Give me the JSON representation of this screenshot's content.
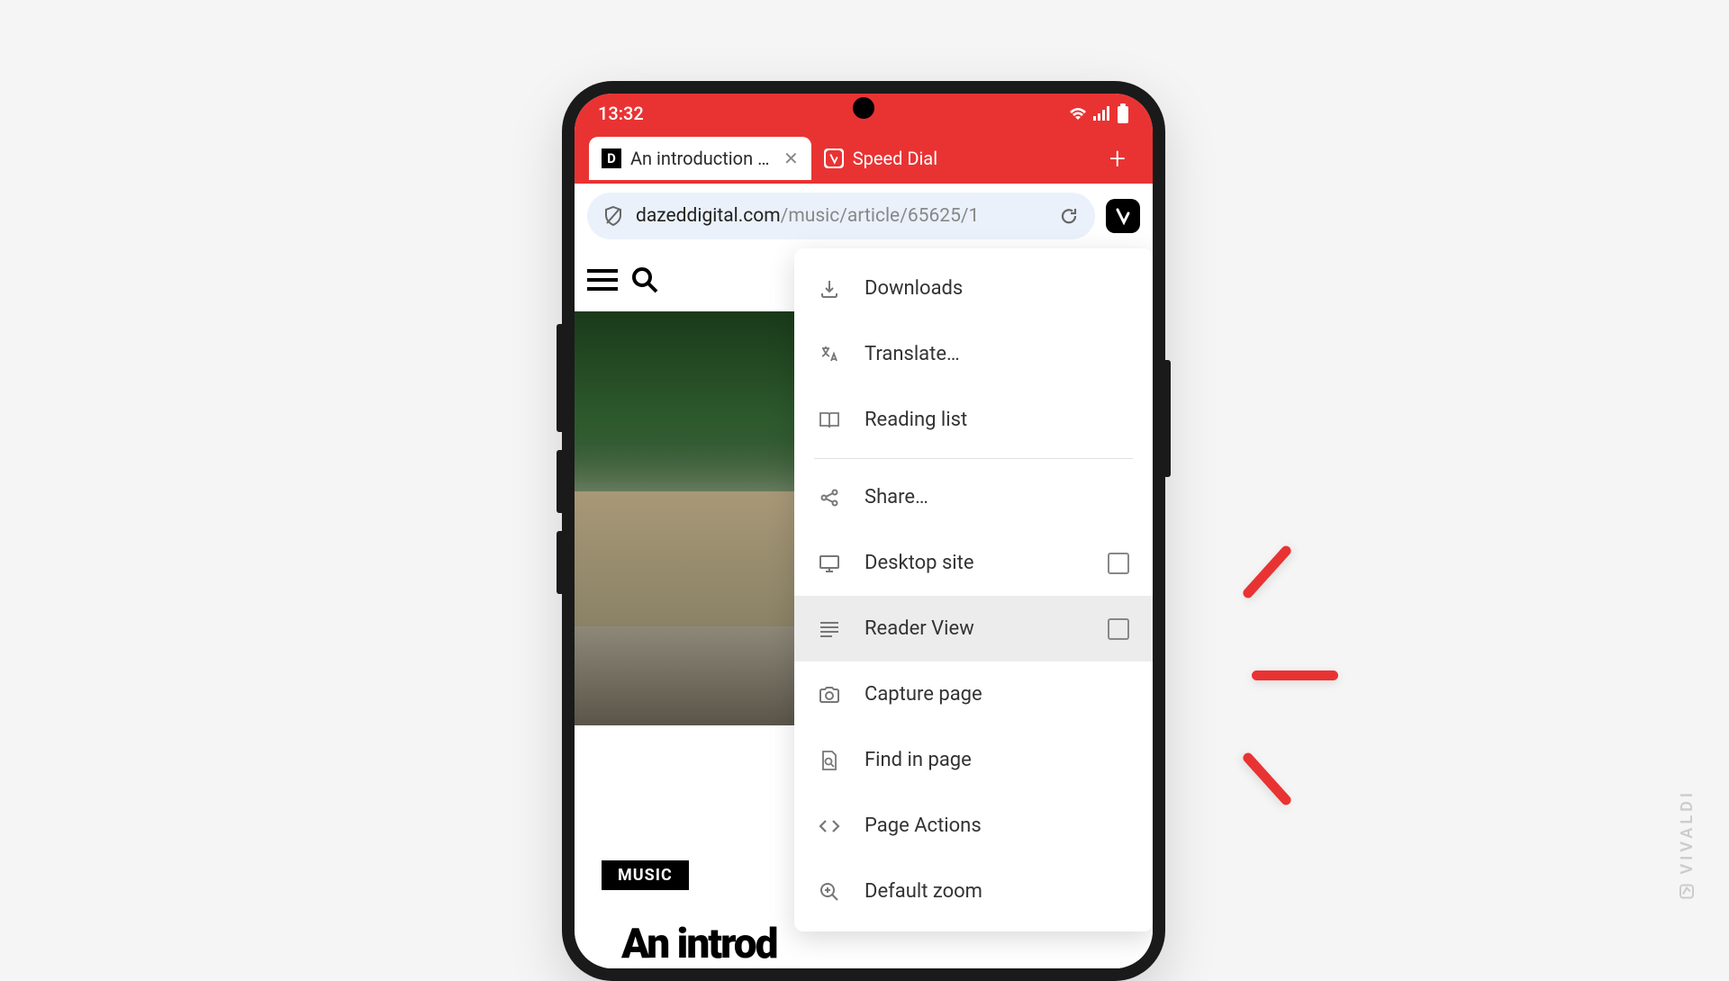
{
  "status": {
    "time": "13:32"
  },
  "tabs": {
    "active": {
      "favicon": "D",
      "title": "An introduction to D"
    },
    "inactive": {
      "title": "Speed Dial"
    }
  },
  "address_bar": {
    "url_host": "dazeddigital.com",
    "url_path": "/music/article/65625/1"
  },
  "page": {
    "category": "MUSIC",
    "article_title": "An introd"
  },
  "menu": {
    "downloads": "Downloads",
    "translate": "Translate…",
    "reading_list": "Reading list",
    "share": "Share…",
    "desktop_site": "Desktop site",
    "reader_view": "Reader View",
    "capture_page": "Capture page",
    "find_in_page": "Find in page",
    "page_actions": "Page Actions",
    "default_zoom": "Default zoom"
  },
  "watermark": "VIVALDI"
}
